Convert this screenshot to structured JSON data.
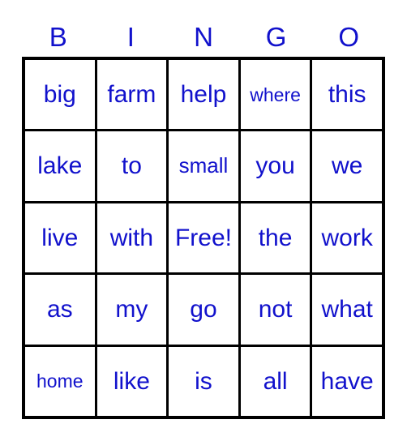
{
  "card": {
    "type": "bingo-card",
    "accent_color": "#1111cc",
    "border_color": "#000000",
    "background_color": "#ffffff",
    "header": {
      "letters": [
        "B",
        "I",
        "N",
        "G",
        "O"
      ]
    },
    "grid": {
      "columns": 5,
      "rows": 5,
      "free_space": "Free!",
      "cells": [
        [
          {
            "text": "big",
            "size": "lg"
          },
          {
            "text": "farm",
            "size": "lg"
          },
          {
            "text": "help",
            "size": "lg"
          },
          {
            "text": "where",
            "size": "sm"
          },
          {
            "text": "this",
            "size": "lg"
          }
        ],
        [
          {
            "text": "lake",
            "size": "lg"
          },
          {
            "text": "to",
            "size": "lg"
          },
          {
            "text": "small",
            "size": "md"
          },
          {
            "text": "you",
            "size": "lg"
          },
          {
            "text": "we",
            "size": "lg"
          }
        ],
        [
          {
            "text": "live",
            "size": "lg"
          },
          {
            "text": "with",
            "size": "lg"
          },
          {
            "text": "Free!",
            "size": "lg"
          },
          {
            "text": "the",
            "size": "lg"
          },
          {
            "text": "work",
            "size": "lg"
          }
        ],
        [
          {
            "text": "as",
            "size": "lg"
          },
          {
            "text": "my",
            "size": "lg"
          },
          {
            "text": "go",
            "size": "lg"
          },
          {
            "text": "not",
            "size": "lg"
          },
          {
            "text": "what",
            "size": "lg"
          }
        ],
        [
          {
            "text": "home",
            "size": "sm"
          },
          {
            "text": "like",
            "size": "lg"
          },
          {
            "text": "is",
            "size": "lg"
          },
          {
            "text": "all",
            "size": "lg"
          },
          {
            "text": "have",
            "size": "lg"
          }
        ]
      ]
    }
  }
}
